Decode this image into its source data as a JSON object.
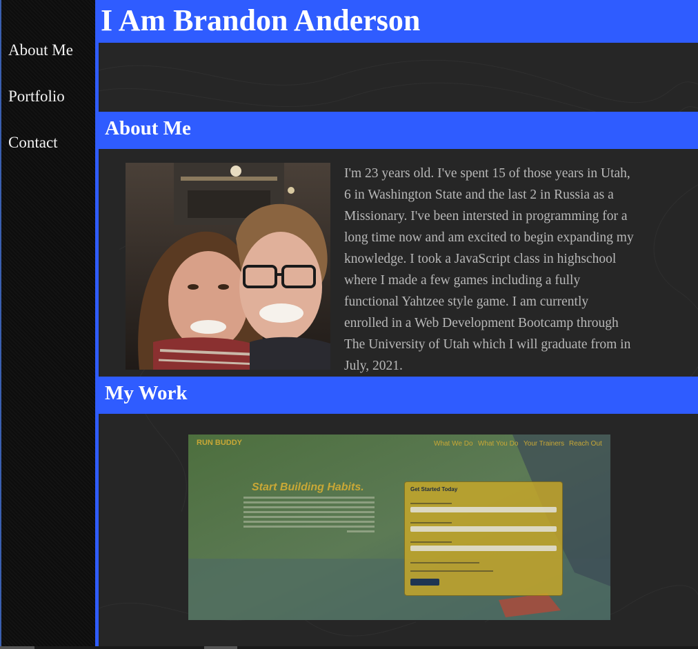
{
  "nav": {
    "items": [
      "About Me",
      "Portfolio",
      "Contact"
    ]
  },
  "header": {
    "title": "I Am Brandon Anderson"
  },
  "about": {
    "heading": "About Me",
    "bio": "I'm 23 years old. I've spent 15 of those years in Utah, 6 in Washington State and the last 2 in Russia as a Missionary. I've been intersted in programming for a long time now and am excited to begin expanding my knowledge. I took a JavaScript class in highschool where I made a few games including a fully functional Yahtzee style game. I am currently enrolled in a Web Development Bootcamp through The University of Utah which I will graduate from in July, 2021."
  },
  "work": {
    "heading": "My Work",
    "project": {
      "brand": "RUN BUDDY",
      "nav": [
        "What We Do",
        "What You Do",
        "Your Trainers",
        "Reach Out"
      ],
      "headline": "Start Building Habits.",
      "form_title": "Get Started Today"
    }
  },
  "colors": {
    "accent": "#2f5cff",
    "sidebar": "#0d0d0d",
    "background": "#262626",
    "text": "#b8b8b8"
  }
}
